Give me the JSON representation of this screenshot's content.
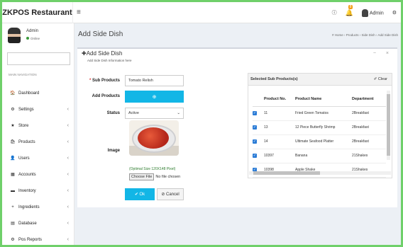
{
  "app": {
    "title": "ZKPOS Restaurant",
    "toggle": "≡"
  },
  "topbar": {
    "info_icon": "❶",
    "bell_icon": "🔔",
    "bell_count": "8",
    "user_name": "Admin",
    "share_icon": "⚙"
  },
  "sidebar": {
    "user_name": "Admin",
    "status": "Online",
    "nav_header": "MAIN NAVIGATION",
    "items": [
      {
        "label": "Dashboard",
        "icon": "🏠",
        "chevron": ""
      },
      {
        "label": "Settings",
        "icon": "⚙",
        "chevron": "‹"
      },
      {
        "label": "Store",
        "icon": "★",
        "chevron": "‹"
      },
      {
        "label": "Products",
        "icon": "🛍",
        "chevron": "‹"
      },
      {
        "label": "Users",
        "icon": "👤",
        "chevron": "‹"
      },
      {
        "label": "Accounts",
        "icon": "▦",
        "chevron": "‹"
      },
      {
        "label": "Inventory",
        "icon": "▬",
        "chevron": "‹"
      },
      {
        "label": "Ingredients",
        "icon": "+",
        "chevron": "‹"
      },
      {
        "label": "Database",
        "icon": "▤",
        "chevron": "‹"
      },
      {
        "label": "Pos Reports",
        "icon": "⚙",
        "chevron": "‹"
      }
    ]
  },
  "page": {
    "title": "Add Side Dish",
    "breadcrumb": "# Home › Products › Side Dish › Add Side Dish"
  },
  "box": {
    "title": "Add Side Dish",
    "subtitle": "Add Side Dish Information here",
    "tools": "− ×"
  },
  "form": {
    "sub_products_label": "Sub Products",
    "sub_products_value": "Tomato Relish",
    "add_products_label": "Add Products",
    "add_button": "⊕",
    "status_label": "Status",
    "status_value": "Active",
    "image_label": "Image",
    "image_note": "(Optimal Size 120X148 Pixel)",
    "file_button": "Choose File",
    "file_status": "No file chosen",
    "ok_label": "✔ Ok",
    "cancel_label": "⊘ Cancel"
  },
  "selected": {
    "title": "Selected Sub Products(s)",
    "clear": "✐ Clear",
    "columns": [
      "Product No.",
      "Product Name",
      "Department"
    ],
    "rows": [
      [
        "11",
        "Fried Green Tomatos",
        "2Breakfast"
      ],
      [
        "13",
        "12 Piece Butterfly Shrimp",
        "2Breakfast"
      ],
      [
        "14",
        "Ultimate Seafood Platter",
        "2Breakfast"
      ],
      [
        "10397",
        "Banana",
        "21Shakes"
      ],
      [
        "10398",
        "Apple Shake",
        "21Shakes"
      ]
    ]
  }
}
